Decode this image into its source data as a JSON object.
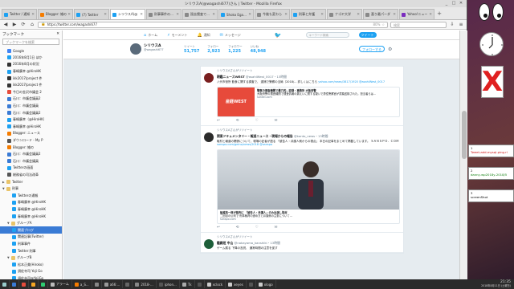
{
  "window": {
    "title": "シリウスA(@wagashi677)さん | Twitter - Mozilla Firefox",
    "controls": [
      "_",
      "□",
      "✕"
    ]
  },
  "tabs": [
    {
      "label": "Twitter / 通知",
      "color": "#1da1f2",
      "active": false
    },
    {
      "label": "Blogger: 雑の",
      "color": "#f57c00",
      "active": false
    },
    {
      "label": "(7) Twitter",
      "color": "#1da1f2",
      "active": false
    },
    {
      "label": "シリウスA(@",
      "color": "#1da1f2",
      "active": true
    },
    {
      "label": "刑事事件の裁判の",
      "color": "#888888",
      "active": false
    },
    {
      "label": "過去捜査で冤罪に",
      "color": "#888888",
      "active": false
    },
    {
      "label": "Shoko Egawa",
      "color": "#1da1f2",
      "active": false
    },
    {
      "label": "今後も変わら",
      "color": "#888888",
      "active": false
    },
    {
      "label": "刑事と弁護",
      "color": "#1da1f2",
      "active": false
    },
    {
      "label": "ナゴヤ大学",
      "color": "#888888",
      "active": false
    },
    {
      "label": "喜り最パーダ",
      "color": "#888888",
      "active": false
    },
    {
      "label": "Yahoo!ニュー",
      "color": "#7b2cbf",
      "active": false
    }
  ],
  "nav": {
    "url": "https://twitter.com/wagashi677",
    "zoom": "80%",
    "search_placeholder": "検索"
  },
  "sidebar": {
    "title": "ブックマーク",
    "search_placeholder": "ブックマークを検索",
    "items": [
      {
        "label": "Google",
        "type": "link",
        "color": "#4285f4",
        "indent": 1
      },
      {
        "label": "2016年8月1日 ほか",
        "type": "link",
        "color": "#1da1f2",
        "indent": 1
      },
      {
        "label": "2016年8月の状況",
        "type": "link",
        "color": "#333333",
        "indent": 1
      },
      {
        "label": "春嶋廣幸 @HiroHK",
        "type": "link",
        "color": "#1da1f2",
        "indent": 1
      },
      {
        "label": "ikk2017/project 件",
        "type": "link",
        "color": "#333333",
        "indent": 1
      },
      {
        "label": "ikk2017/project 件",
        "type": "link",
        "color": "#333333",
        "indent": 1
      },
      {
        "label": "今日の金沢市議会 2",
        "type": "link",
        "color": "#e74c3c",
        "indent": 1
      },
      {
        "label": "石川：市議会議員2",
        "type": "link",
        "color": "#3a7bd5",
        "indent": 1
      },
      {
        "label": "石川：市議会議員",
        "type": "link",
        "color": "#3a7bd5",
        "indent": 1
      },
      {
        "label": "石川：市議会議員2",
        "type": "link",
        "color": "#3a7bd5",
        "indent": 1
      },
      {
        "label": "春嶋廣幸（@HiroHK）",
        "type": "link",
        "color": "#1da1f2",
        "indent": 1
      },
      {
        "label": "春嶋廣幸 @HiroHK",
        "type": "link",
        "color": "#1da1f2",
        "indent": 1
      },
      {
        "label": "Blogger: ニュース",
        "type": "link",
        "color": "#f57c00",
        "indent": 1
      },
      {
        "label": "ダウンロード - My P",
        "type": "link",
        "color": "#555555",
        "indent": 1
      },
      {
        "label": "Blogger: 雑の",
        "type": "link",
        "color": "#f57c00",
        "indent": 1
      },
      {
        "label": "石川：市議会議員2",
        "type": "link",
        "color": "#3a7bd5",
        "indent": 1
      },
      {
        "label": "石川：市議会議員",
        "type": "link",
        "color": "#3a7bd5",
        "indent": 1
      },
      {
        "label": "Twitterの画面",
        "type": "link",
        "color": "#1da1f2",
        "indent": 1
      },
      {
        "label": "総務省の司法改革",
        "type": "link",
        "color": "#555555",
        "indent": 1
      },
      {
        "label": "Twitter",
        "type": "folder",
        "indent": 0
      },
      {
        "label": "刑事",
        "type": "folder",
        "indent": 0,
        "open": true
      },
      {
        "label": "Twitterの通報",
        "type": "link",
        "color": "#1da1f2",
        "indent": 2
      },
      {
        "label": "春嶋廣幸 @HiroHK",
        "type": "link",
        "color": "#1da1f2",
        "indent": 2
      },
      {
        "label": "春嶋廣幸 @HiroHK",
        "type": "link",
        "color": "#1da1f2",
        "indent": 2
      },
      {
        "label": "春嶋廣幸 @HiroHK",
        "type": "link",
        "color": "#1da1f2",
        "indent": 2
      },
      {
        "label": "グループA",
        "type": "folder",
        "indent": 1,
        "open": true
      },
      {
        "label": "関連ブログ",
        "type": "link",
        "color": "#1da1f2",
        "indent": 2,
        "selected": true
      },
      {
        "label": "関連記事(Twitter)",
        "type": "link",
        "color": "#1da1f2",
        "indent": 2
      },
      {
        "label": "刑事事件",
        "type": "link",
        "color": "#1da1f2",
        "indent": 2
      },
      {
        "label": "Twitter:刑事",
        "type": "link",
        "color": "#1da1f2",
        "indent": 2
      },
      {
        "label": "グループB",
        "type": "folder",
        "indent": 1,
        "open": true
      },
      {
        "label": "松本正美(Hiroko)",
        "type": "link",
        "color": "#1da1f2",
        "indent": 2
      },
      {
        "label": "須佐寺司 Yoji Go",
        "type": "link",
        "color": "#1da1f2",
        "indent": 2
      },
      {
        "label": "須佐寺司@YojiGo",
        "type": "link",
        "color": "#1da1f2",
        "indent": 2
      },
      {
        "label": "須佐寺司",
        "type": "link",
        "color": "#1da1f2",
        "indent": 2
      }
    ]
  },
  "twitter": {
    "top_nav": [
      {
        "label": "ホーム",
        "icon": "home-icon"
      },
      {
        "label": "モーメント",
        "icon": "bolt-icon"
      },
      {
        "label": "通知",
        "icon": "bell-icon"
      },
      {
        "label": "メッセージ",
        "icon": "mail-icon"
      }
    ],
    "search_placeholder": "キーワード検索",
    "tweet_button": "ツイート",
    "profile": {
      "name": "シリウスA",
      "handle": "@wagashi677",
      "stats": [
        {
          "label": "ツイート",
          "value": "51,757"
        },
        {
          "label": "フォロー",
          "value": "2,923"
        },
        {
          "label": "フォロワー",
          "value": "1,225"
        },
        {
          "label": "いいね",
          "value": "48,948"
        }
      ],
      "follow_button": "フォローする"
    },
    "tweets": [
      {
        "retweet_line": "シリウスAさんがリツイート",
        "author": "朝鑑ニュースWEST",
        "handle": "@asahiWest_0017",
        "time": "・13時間",
        "avatar_color": "#7a1f1f",
        "text": "八代市役所 飲食に関する調査で、 逮捕で警察の当局（2018/... 詳しくはこちら",
        "link": "yahoo.com/news/3817/1920 @asahiWest_0017",
        "card": {
          "image_label": "産経WEST",
          "title": "警察の捜査機関で暴力的…容疑・事務所 大阪府警",
          "desc": "大阪府警の捜査機関で捜査情報の漏えいに関する疑いで男性警察官が書類送検された。担当者らは…",
          "url": "sankei.com"
        },
        "actions": [
          "↩",
          "⟲",
          "♡",
          "✉"
        ]
      },
      {
        "retweet_line": "シリウスAさんがリツイート",
        "author": "関東ドキュメンタリー・報道ニュース・現場からの報告",
        "handle": "@kanto_news",
        "time": "・13時間",
        "avatar_color": "#2b2b2b",
        "text": "取材と報道の関係について、現場の記者が語る 「被告人・弁護人側からの視点」 本日の記事をまとめて掲載しています。 ＳＡＮＳＰＯ．ＣＯＭ",
        "link": "sanspo.com/geino/news/2018 @sanspo",
        "card": {
          "title": "船越英一郎が裁判に 「被告人・弁護人」のみ出演し取材",
          "desc": "二回目の公判で 刑事裁判の進め方と弁護側の主張について…",
          "url": "sanspo.com"
        },
        "actions": [
          "↩",
          "⟲",
          "♡",
          "✉"
        ]
      },
      {
        "retweet_line": "シリウスAさんがリツイート",
        "author": "鑑識班 中山",
        "handle": "@nakayama_kanshiki",
        "time": "・13時間",
        "avatar_color": "#1e5f3a",
        "text": "ゲーム展る 下降の言説、 通常時間の注意を促す",
        "link": "",
        "actions": []
      }
    ]
  },
  "desktop": {
    "terminals": [
      {
        "line1": "1",
        "line2": "Tweet-add-mysql-ping.rl",
        "tone": "red"
      },
      {
        "line1": "2",
        "line2": "danny-wp2018y-2018/5",
        "tone": "green"
      },
      {
        "line1": "3",
        "line2": "screenShot",
        "tone": "plain"
      }
    ]
  },
  "taskbar": {
    "items": [
      {
        "label": "",
        "color": "#3a7bd5"
      },
      {
        "label": "",
        "color": "#e74c3c"
      },
      {
        "label": "",
        "color": "#f5a623"
      },
      {
        "label": "",
        "color": "#2ecc71"
      },
      {
        "label": "アラーム",
        "color": "#bbbbbb"
      },
      {
        "label": "a_S...",
        "color": "#f57c00"
      },
      {
        "label": "",
        "color": "#888888"
      },
      {
        "label": "a66:...",
        "color": "#999999"
      },
      {
        "label": "",
        "color": "#666666"
      },
      {
        "label": "2018-...",
        "color": "#888888"
      },
      {
        "label": "iphon...",
        "color": "#555555"
      },
      {
        "label": "Tk",
        "color": "#aaaaaa"
      },
      {
        "label": "",
        "color": "#555555"
      },
      {
        "label": "xclock",
        "color": "#cccccc"
      },
      {
        "label": "xeyes",
        "color": "#cccccc"
      },
      {
        "label": "",
        "color": "#555555"
      },
      {
        "label": "xlogo",
        "color": "#cccccc"
      }
    ],
    "time": "21:35",
    "date": "2018年8月11日 (土曜日)"
  }
}
